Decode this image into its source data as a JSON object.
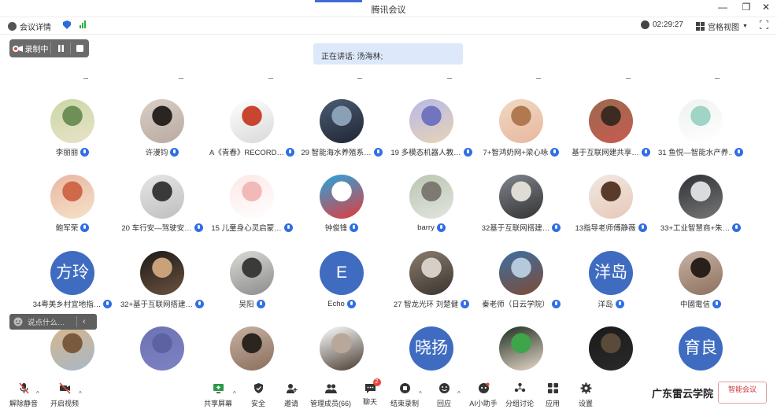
{
  "window": {
    "title": "腾讯会议",
    "controls": [
      "—",
      "❐",
      "✕"
    ]
  },
  "infobar": {
    "meeting_details": "会议详情",
    "timer": "02:29:27",
    "view_mode": "宫格视图"
  },
  "recording": {
    "label": "录制中"
  },
  "speaking": {
    "text": "正在讲话: 汤海林;"
  },
  "participants": [
    {
      "name": "李丽丽",
      "avatar": "photo",
      "colors": [
        "#c9d7a6",
        "#6f8f58",
        "#e9e3c8"
      ]
    },
    {
      "name": "许漫钧",
      "avatar": "photo",
      "colors": [
        "#d8cfc7",
        "#2a2522",
        "#b9aaa0"
      ]
    },
    {
      "name": "A《青春》RECORD…",
      "avatar": "photo",
      "colors": [
        "#ffffff",
        "#c8452f",
        "#d9d9d9"
      ]
    },
    {
      "name": "29 智能海水养殖系…",
      "avatar": "photo",
      "colors": [
        "#4c5c74",
        "#8aa0b7",
        "#1f2633"
      ]
    },
    {
      "name": "19 多模态机器人教…",
      "avatar": "photo",
      "colors": [
        "#b7b8e8",
        "#7274c0",
        "#e8d4b5"
      ]
    },
    {
      "name": "7+智鸿奶网+梁心咏",
      "avatar": "photo",
      "colors": [
        "#f0d9c2",
        "#b07950",
        "#e8b7a0"
      ]
    },
    {
      "name": "基于互联网建共享…",
      "avatar": "photo",
      "colors": [
        "#9a6a4f",
        "#3d2a20",
        "#c85a50"
      ]
    },
    {
      "name": "31 鱼悦—智能水产养…",
      "avatar": "photo",
      "colors": [
        "#eef3ef",
        "#9fd4c6",
        "#ffffff"
      ]
    },
    {
      "name": "鲍军荣",
      "avatar": "photo",
      "colors": [
        "#e9b6a3",
        "#d0684a",
        "#f5e2c8"
      ]
    },
    {
      "name": "20 车行安—驾驶安…",
      "avatar": "photo",
      "colors": [
        "#e6e6e6",
        "#3a3a3a",
        "#bfbfbf"
      ]
    },
    {
      "name": "15 儿童身心灵启蒙…",
      "avatar": "photo",
      "colors": [
        "#fde7e7",
        "#f3b9b9",
        "#ffffff"
      ]
    },
    {
      "name": "钟俊锋",
      "avatar": "photo",
      "colors": [
        "#27a6e0",
        "#ffffff",
        "#e33b3b"
      ]
    },
    {
      "name": "barry",
      "avatar": "photo",
      "colors": [
        "#b9c7b0",
        "#7d7a72",
        "#e3e3e0"
      ]
    },
    {
      "name": "32基于互联网搭建…",
      "avatar": "photo",
      "colors": [
        "#7f858d",
        "#dfdcd6",
        "#333333"
      ]
    },
    {
      "name": "13指导老师傅静薇",
      "avatar": "photo",
      "colors": [
        "#f1e8e2",
        "#5a3b2a",
        "#e7c9b8"
      ]
    },
    {
      "name": "33+工业智慧商+朱…",
      "avatar": "photo",
      "colors": [
        "#2e3135",
        "#d9dcdf",
        "#777777"
      ]
    },
    {
      "name": "34粤美乡村宜地指…",
      "avatar": "text",
      "text": "方玲",
      "colors": [
        "#3f6cc0"
      ]
    },
    {
      "name": "32+基于互联网搭建…",
      "avatar": "photo",
      "colors": [
        "#1d1a17",
        "#c9a27a",
        "#6a5240"
      ]
    },
    {
      "name": "吴阳",
      "avatar": "photo",
      "colors": [
        "#dadad6",
        "#3b3b3b",
        "#8c8c8c"
      ]
    },
    {
      "name": "Echo",
      "avatar": "text",
      "text": "E",
      "colors": [
        "#3f6cc0"
      ]
    },
    {
      "name": "27 智龙光环 刘楚健",
      "avatar": "photo",
      "colors": [
        "#8a7d70",
        "#d6cfc7",
        "#3a342e"
      ]
    },
    {
      "name": "秦老师（日云学院）",
      "avatar": "photo",
      "colors": [
        "#3e6fa3",
        "#b5c9dc",
        "#7c4b36"
      ]
    },
    {
      "name": "洋岛",
      "avatar": "text",
      "text": "洋岛",
      "colors": [
        "#3f6cc0"
      ]
    },
    {
      "name": "中國電信",
      "avatar": "photo",
      "colors": [
        "#c7b4a5",
        "#2a201b",
        "#8e6f5e"
      ]
    },
    {
      "name": "",
      "avatar": "photo",
      "colors": [
        "#d6b58b",
        "#7a5a3d",
        "#a8b8c8"
      ]
    },
    {
      "name": "",
      "avatar": "photo",
      "colors": [
        "#6d72b2",
        "#5d62a2",
        "#7d82c2"
      ]
    },
    {
      "name": "",
      "avatar": "photo",
      "colors": [
        "#c7b2a3",
        "#2c241f",
        "#8a6e5d"
      ]
    },
    {
      "name": "",
      "avatar": "photo",
      "colors": [
        "#ffffff",
        "#b8a89a",
        "#4a3d33"
      ]
    },
    {
      "name": "",
      "avatar": "text",
      "text": "晓扬",
      "colors": [
        "#3f6cc0"
      ]
    },
    {
      "name": "",
      "avatar": "photo",
      "colors": [
        "#1f2e22",
        "#3fa54a",
        "#e6d9c9"
      ]
    },
    {
      "name": "",
      "avatar": "photo",
      "colors": [
        "#1a1a1a",
        "#5a4a3a",
        "#2a2a2a"
      ]
    },
    {
      "name": "",
      "avatar": "text",
      "text": "育良",
      "colors": [
        "#3f6cc0"
      ]
    }
  ],
  "chat": {
    "placeholder": "说点什么…"
  },
  "toolbar": {
    "unmute": "解除静音",
    "start_video": "开启视频",
    "share_screen": "共享屏幕",
    "security": "安全",
    "invite": "邀请",
    "members": "管理成员(66)",
    "chat": "聊天",
    "chat_badge": "2",
    "end_recording": "结束录制",
    "react": "回应",
    "ai_assistant": "AI小助手",
    "breakout": "分组讨论",
    "apps": "应用",
    "settings": "设置"
  },
  "watermark": {
    "left": "广东雷云学院",
    "right": "智能会议"
  }
}
